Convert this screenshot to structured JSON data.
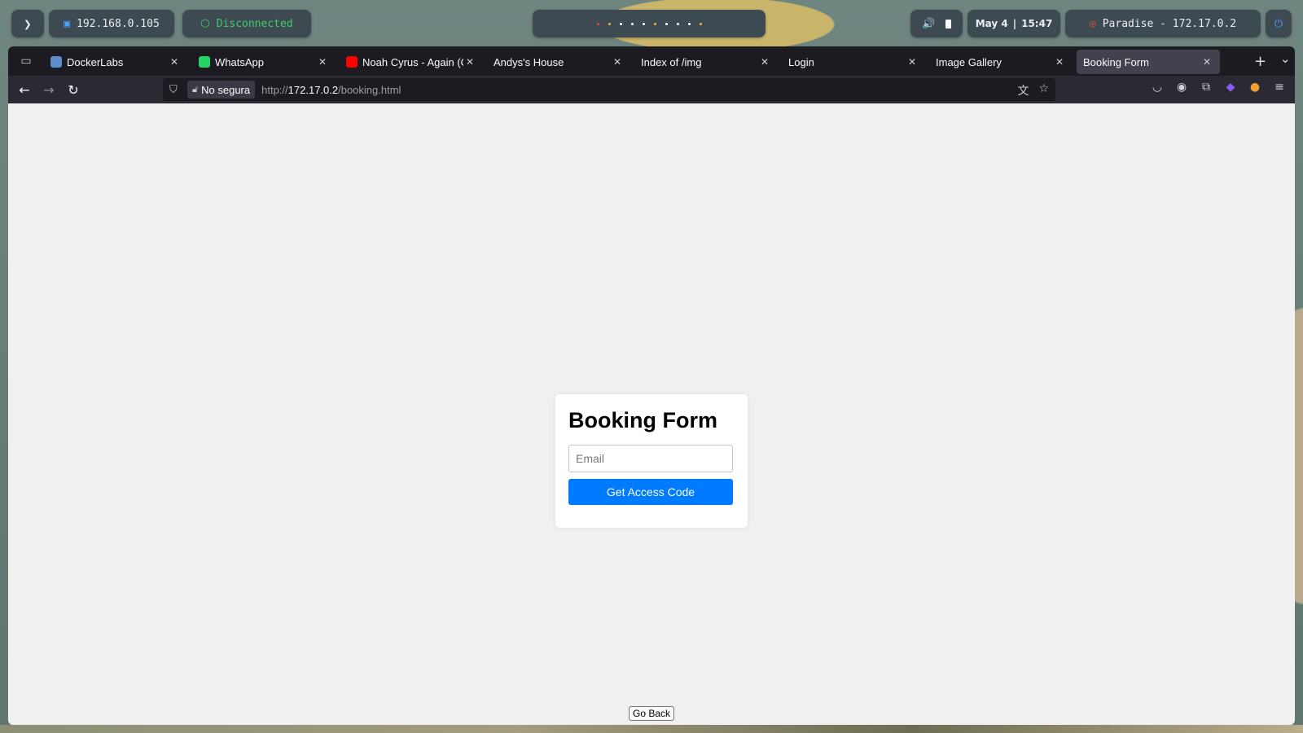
{
  "topbar": {
    "ip": "192.168.0.105",
    "vpn_status": "Disconnected",
    "workspace_dot_colors": [
      "#e04848",
      "#f0b429",
      "#ffffff",
      "#ffffff",
      "#ffffff",
      "#f0b429",
      "#ffffff",
      "#ffffff",
      "#ffffff",
      "#f0b429"
    ],
    "date": "May 4",
    "time": "15:47",
    "target": "Paradise - 172.17.0.2"
  },
  "browser": {
    "tabs": [
      {
        "label": "DockerLabs",
        "favicon_color": "#5c8ec9",
        "active": false
      },
      {
        "label": "WhatsApp",
        "favicon_color": "#25d366",
        "active": false
      },
      {
        "label": "Noah Cyrus - Again (Offi",
        "favicon_color": "#ff0000",
        "active": false
      },
      {
        "label": "Andys's House",
        "favicon_color": "",
        "active": false
      },
      {
        "label": "Index of /img",
        "favicon_color": "",
        "active": false
      },
      {
        "label": "Login",
        "favicon_color": "",
        "active": false
      },
      {
        "label": "Image Gallery",
        "favicon_color": "",
        "active": false
      },
      {
        "label": "Booking Form",
        "favicon_color": "",
        "active": true
      }
    ],
    "security_label": "No segura",
    "url_prefix": "http://",
    "url_host": "172.17.0.2",
    "url_path": "/booking.html"
  },
  "page": {
    "heading": "Booking Form",
    "email_placeholder": "Email",
    "email_value": "",
    "submit_label": "Get Access Code",
    "back_label": "Go Back"
  },
  "colors": {
    "primary_button": "#007bff",
    "vpn_status": "#3ecf6a"
  }
}
